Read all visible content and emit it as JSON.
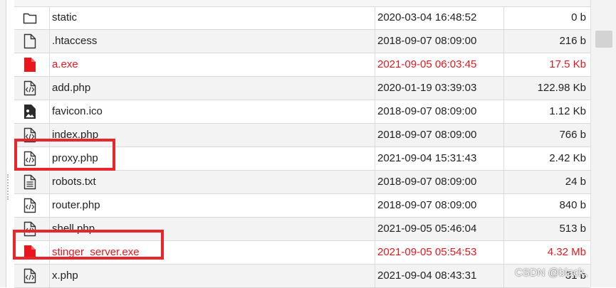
{
  "files": [
    {
      "name": "static",
      "date": "2020-03-04 16:48:52",
      "size": "0 b",
      "icon": "folder-icon",
      "red": false
    },
    {
      "name": ".htaccess",
      "date": "2018-09-07 08:09:00",
      "size": "216 b",
      "icon": "file-icon",
      "red": false
    },
    {
      "name": "a.exe",
      "date": "2021-09-05 06:03:45",
      "size": "17.5 Kb",
      "icon": "red-file-icon",
      "red": true
    },
    {
      "name": "add.php",
      "date": "2020-01-19 03:39:03",
      "size": "122.98 Kb",
      "icon": "code-file-icon",
      "red": false
    },
    {
      "name": "favicon.ico",
      "date": "2018-09-07 08:09:00",
      "size": "1.12 Kb",
      "icon": "image-file-icon",
      "red": false
    },
    {
      "name": "index.php",
      "date": "2018-09-07 08:09:00",
      "size": "766 b",
      "icon": "code-file-icon",
      "red": false
    },
    {
      "name": "proxy.php",
      "date": "2021-09-04 15:31:43",
      "size": "2.42 Kb",
      "icon": "code-file-icon",
      "red": false
    },
    {
      "name": "robots.txt",
      "date": "2018-09-07 08:09:00",
      "size": "24 b",
      "icon": "text-file-icon",
      "red": false
    },
    {
      "name": "router.php",
      "date": "2018-09-07 08:09:00",
      "size": "840 b",
      "icon": "code-file-icon",
      "red": false
    },
    {
      "name": "shell.php",
      "date": "2021-09-05 05:46:04",
      "size": "513 b",
      "icon": "code-file-icon",
      "red": false
    },
    {
      "name": "stinger_server.exe",
      "date": "2021-09-05 05:54:53",
      "size": "4.32 Mb",
      "icon": "red-file-icon",
      "red": true
    },
    {
      "name": "x.php",
      "date": "2021-09-04 08:43:31",
      "size": "31 b",
      "icon": "code-file-icon",
      "red": false
    }
  ],
  "watermark": "CSDN @black、",
  "colors": {
    "highlight": "#e8262b",
    "red_text": "#e8171d"
  }
}
